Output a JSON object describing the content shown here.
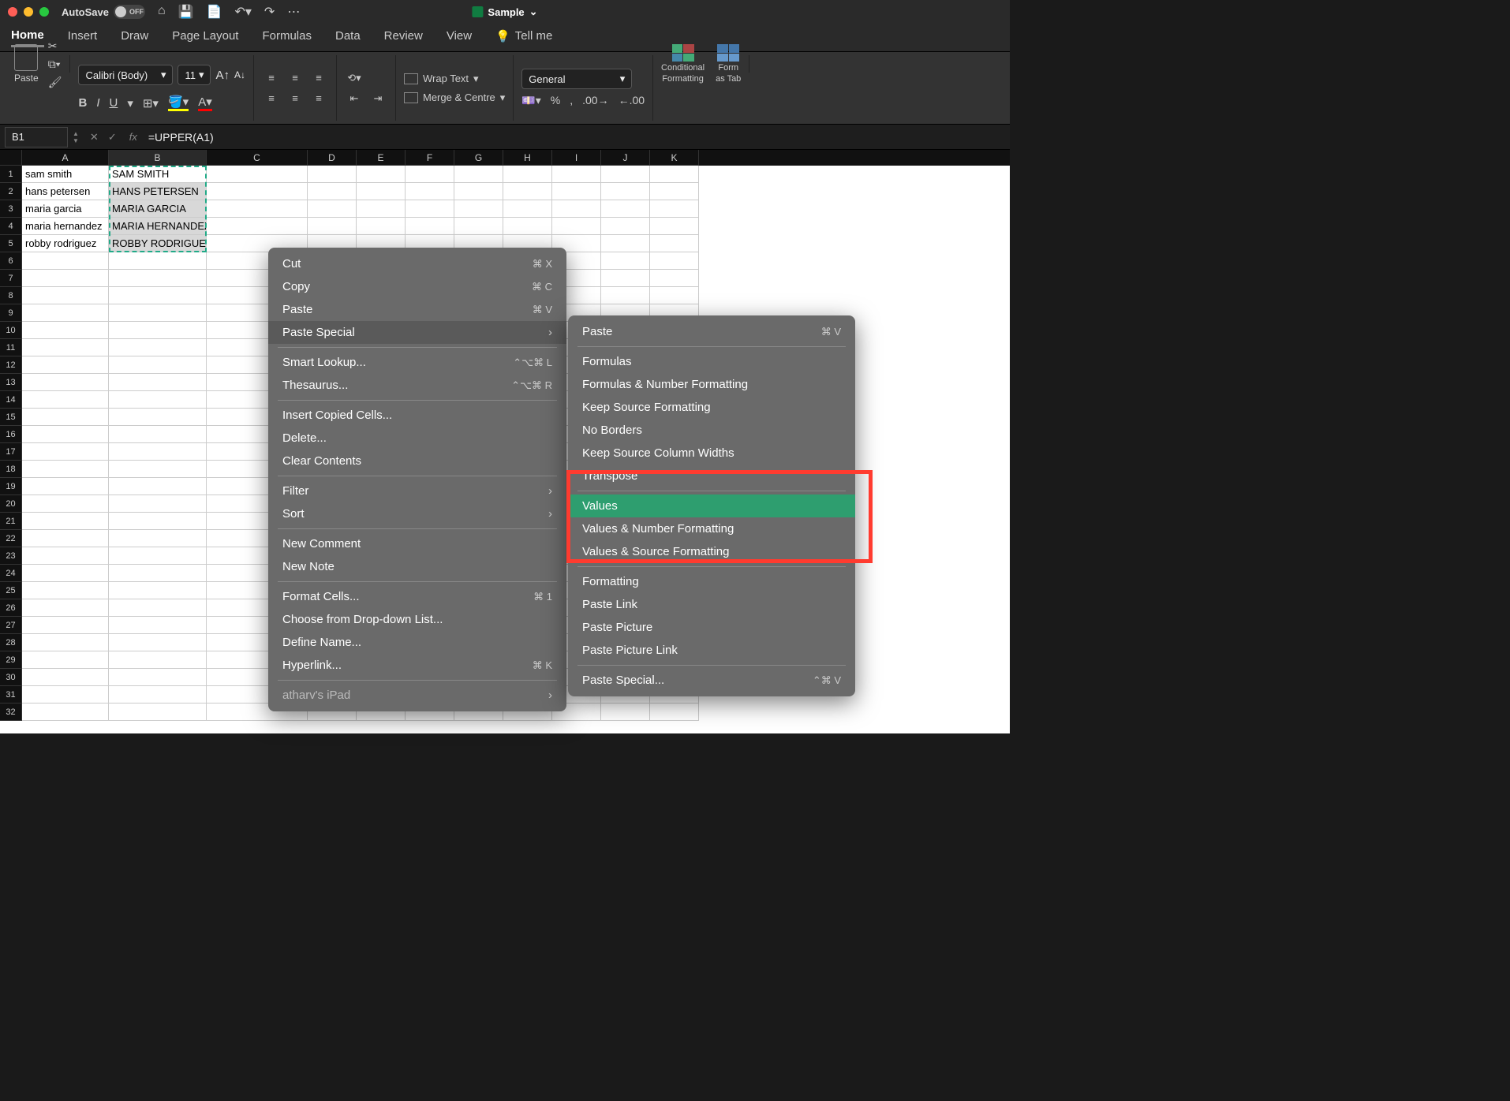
{
  "titlebar": {
    "autosave_label": "AutoSave",
    "autosave_state": "OFF",
    "doc_name": "Sample"
  },
  "tabs": {
    "home": "Home",
    "insert": "Insert",
    "draw": "Draw",
    "page_layout": "Page Layout",
    "formulas": "Formulas",
    "data": "Data",
    "review": "Review",
    "view": "View",
    "tell_me": "Tell me"
  },
  "ribbon": {
    "paste": "Paste",
    "font_name": "Calibri (Body)",
    "font_size": "11",
    "wrap_text": "Wrap Text",
    "merge_centre": "Merge & Centre",
    "number_format": "General",
    "cond_fmt_l1": "Conditional",
    "cond_fmt_l2": "Formatting",
    "fmt_table_l1": "Form",
    "fmt_table_l2": "as Tab"
  },
  "formula_bar": {
    "cell_ref": "B1",
    "formula": "=UPPER(A1)"
  },
  "columns": [
    "A",
    "B",
    "C",
    "D",
    "E",
    "F",
    "G",
    "H",
    "I",
    "J",
    "K"
  ],
  "row_numbers": [
    "1",
    "2",
    "3",
    "4",
    "5",
    "6",
    "7",
    "8",
    "9",
    "10",
    "11",
    "12",
    "13",
    "14",
    "15",
    "16",
    "17",
    "18",
    "19",
    "20",
    "21",
    "22",
    "23",
    "24",
    "25",
    "26",
    "27",
    "28",
    "29",
    "30",
    "31",
    "32"
  ],
  "cells": {
    "A": [
      "sam smith",
      "hans petersen",
      "maria garcia",
      "maria hernandez",
      "robby rodriguez"
    ],
    "B": [
      "SAM SMITH",
      "HANS PETERSEN",
      "MARIA GARCIA",
      "MARIA HERNANDEZ",
      "ROBBY RODRIGUEZ"
    ]
  },
  "context_menu": {
    "cut": "Cut",
    "cut_sc": "⌘ X",
    "copy": "Copy",
    "copy_sc": "⌘ C",
    "paste": "Paste",
    "paste_sc": "⌘ V",
    "paste_special": "Paste Special",
    "smart_lookup": "Smart Lookup...",
    "smart_sc": "⌃⌥⌘ L",
    "thesaurus": "Thesaurus...",
    "thes_sc": "⌃⌥⌘ R",
    "insert_copied": "Insert Copied Cells...",
    "delete": "Delete...",
    "clear_contents": "Clear Contents",
    "filter": "Filter",
    "sort": "Sort",
    "new_comment": "New Comment",
    "new_note": "New Note",
    "format_cells": "Format Cells...",
    "fc_sc": "⌘ 1",
    "choose_dropdown": "Choose from Drop-down List...",
    "define_name": "Define Name...",
    "hyperlink": "Hyperlink...",
    "hl_sc": "⌘ K",
    "ipad": "atharv's iPad"
  },
  "submenu": {
    "paste": "Paste",
    "paste_sc": "⌘ V",
    "formulas": "Formulas",
    "formulas_num": "Formulas & Number Formatting",
    "keep_src_fmt": "Keep Source Formatting",
    "no_borders": "No Borders",
    "keep_col_widths": "Keep Source Column Widths",
    "transpose": "Transpose",
    "values": "Values",
    "values_num": "Values & Number Formatting",
    "values_src": "Values & Source Formatting",
    "formatting": "Formatting",
    "paste_link": "Paste Link",
    "paste_picture": "Paste Picture",
    "paste_picture_link": "Paste Picture Link",
    "paste_special": "Paste Special...",
    "ps_sc": "⌃⌘ V"
  }
}
